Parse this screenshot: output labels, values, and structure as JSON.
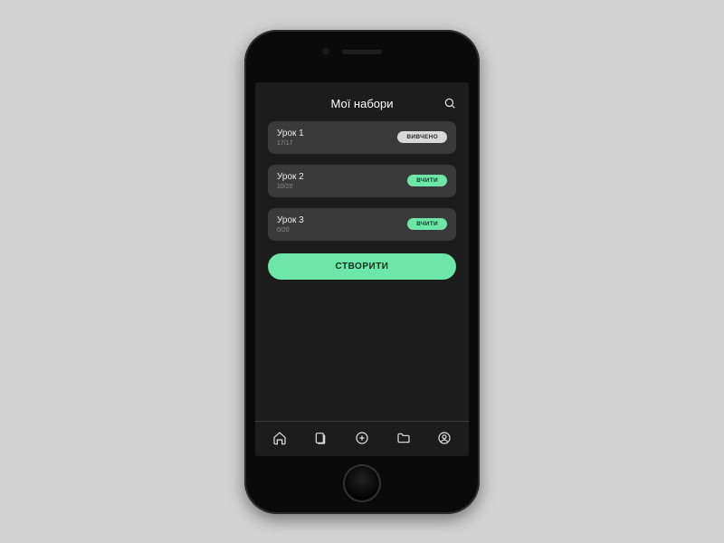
{
  "header": {
    "title": "Мої набори"
  },
  "lessons": [
    {
      "title": "Урок 1",
      "progress": "17/17",
      "badge": "ВИВЧЕНО",
      "badge_style": "grey"
    },
    {
      "title": "Урок 2",
      "progress": "10/20",
      "badge": "ВЧИТИ",
      "badge_style": "green"
    },
    {
      "title": "Урок 3",
      "progress": "0/20",
      "badge": "ВЧИТИ",
      "badge_style": "green"
    }
  ],
  "buttons": {
    "create": "СТВОРИТИ"
  },
  "colors": {
    "accent": "#6de7a7",
    "card_bg": "#3a3a3a",
    "screen_bg": "#1c1c1c",
    "page_bg": "#d3d3d3"
  },
  "tabbar": {
    "items": [
      "home",
      "cards",
      "add",
      "folder",
      "profile"
    ]
  }
}
